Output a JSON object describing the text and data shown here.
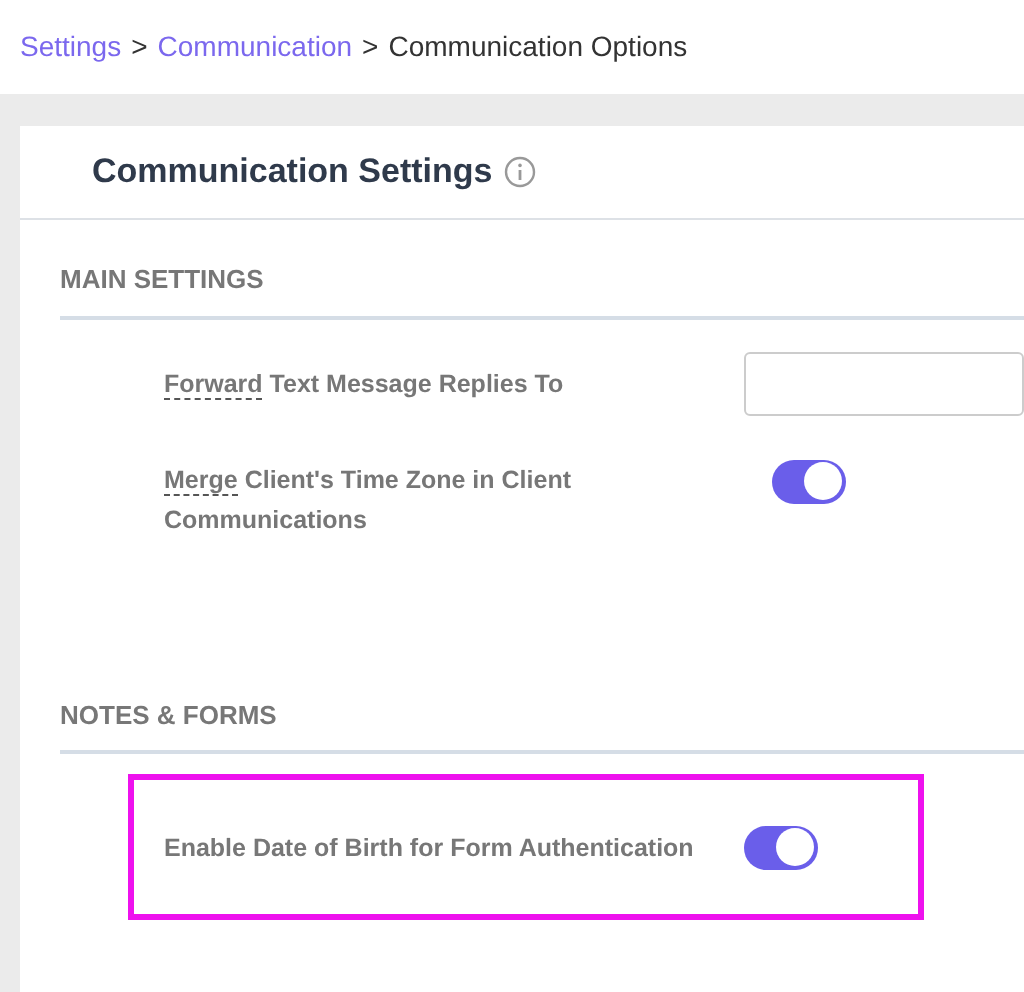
{
  "breadcrumb_separator": ">",
  "breadcrumb": [
    {
      "label": "Settings",
      "link": true
    },
    {
      "label": "Communication",
      "link": true
    },
    {
      "label": "Communication Options",
      "link": false
    }
  ],
  "card": {
    "title": "Communication Settings",
    "sections": [
      {
        "heading": "MAIN SETTINGS",
        "rows": [
          {
            "kind": "text",
            "term": "Forward",
            "label": "Text Message Replies To",
            "highlighted": false
          },
          {
            "kind": "toggle",
            "term": "Merge",
            "label": "Client's Time Zone in Client Communications",
            "on": true,
            "highlighted": false
          }
        ]
      },
      {
        "heading": "NOTES & FORMS",
        "rows": [
          {
            "kind": "toggle",
            "label": "Enable Date of Birth for Form Authentication",
            "on": true,
            "highlighted": true
          }
        ]
      }
    ]
  }
}
